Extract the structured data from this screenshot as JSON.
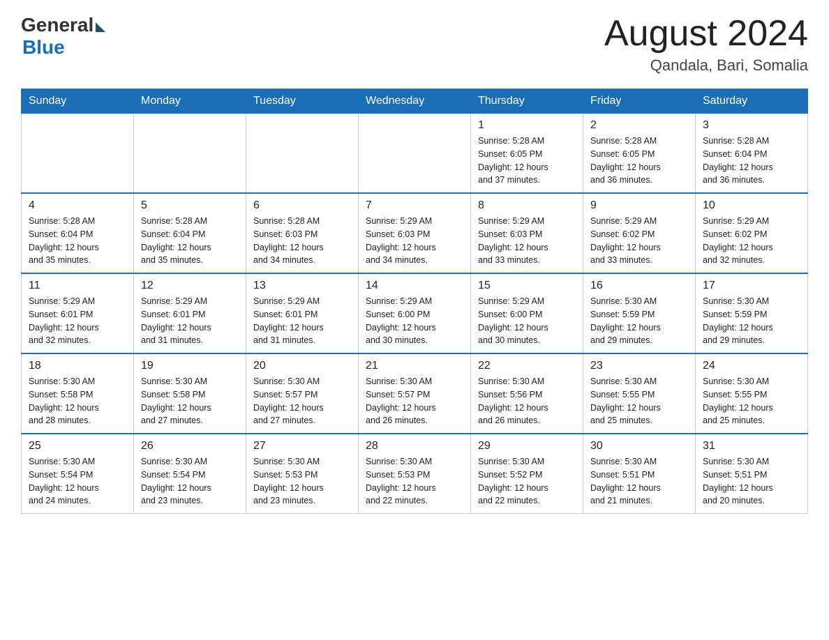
{
  "header": {
    "logo_general": "General",
    "logo_blue": "Blue",
    "month_title": "August 2024",
    "location": "Qandala, Bari, Somalia"
  },
  "days_of_week": [
    "Sunday",
    "Monday",
    "Tuesday",
    "Wednesday",
    "Thursday",
    "Friday",
    "Saturday"
  ],
  "weeks": [
    [
      {
        "day": "",
        "info": ""
      },
      {
        "day": "",
        "info": ""
      },
      {
        "day": "",
        "info": ""
      },
      {
        "day": "",
        "info": ""
      },
      {
        "day": "1",
        "info": "Sunrise: 5:28 AM\nSunset: 6:05 PM\nDaylight: 12 hours\nand 37 minutes."
      },
      {
        "day": "2",
        "info": "Sunrise: 5:28 AM\nSunset: 6:05 PM\nDaylight: 12 hours\nand 36 minutes."
      },
      {
        "day": "3",
        "info": "Sunrise: 5:28 AM\nSunset: 6:04 PM\nDaylight: 12 hours\nand 36 minutes."
      }
    ],
    [
      {
        "day": "4",
        "info": "Sunrise: 5:28 AM\nSunset: 6:04 PM\nDaylight: 12 hours\nand 35 minutes."
      },
      {
        "day": "5",
        "info": "Sunrise: 5:28 AM\nSunset: 6:04 PM\nDaylight: 12 hours\nand 35 minutes."
      },
      {
        "day": "6",
        "info": "Sunrise: 5:28 AM\nSunset: 6:03 PM\nDaylight: 12 hours\nand 34 minutes."
      },
      {
        "day": "7",
        "info": "Sunrise: 5:29 AM\nSunset: 6:03 PM\nDaylight: 12 hours\nand 34 minutes."
      },
      {
        "day": "8",
        "info": "Sunrise: 5:29 AM\nSunset: 6:03 PM\nDaylight: 12 hours\nand 33 minutes."
      },
      {
        "day": "9",
        "info": "Sunrise: 5:29 AM\nSunset: 6:02 PM\nDaylight: 12 hours\nand 33 minutes."
      },
      {
        "day": "10",
        "info": "Sunrise: 5:29 AM\nSunset: 6:02 PM\nDaylight: 12 hours\nand 32 minutes."
      }
    ],
    [
      {
        "day": "11",
        "info": "Sunrise: 5:29 AM\nSunset: 6:01 PM\nDaylight: 12 hours\nand 32 minutes."
      },
      {
        "day": "12",
        "info": "Sunrise: 5:29 AM\nSunset: 6:01 PM\nDaylight: 12 hours\nand 31 minutes."
      },
      {
        "day": "13",
        "info": "Sunrise: 5:29 AM\nSunset: 6:01 PM\nDaylight: 12 hours\nand 31 minutes."
      },
      {
        "day": "14",
        "info": "Sunrise: 5:29 AM\nSunset: 6:00 PM\nDaylight: 12 hours\nand 30 minutes."
      },
      {
        "day": "15",
        "info": "Sunrise: 5:29 AM\nSunset: 6:00 PM\nDaylight: 12 hours\nand 30 minutes."
      },
      {
        "day": "16",
        "info": "Sunrise: 5:30 AM\nSunset: 5:59 PM\nDaylight: 12 hours\nand 29 minutes."
      },
      {
        "day": "17",
        "info": "Sunrise: 5:30 AM\nSunset: 5:59 PM\nDaylight: 12 hours\nand 29 minutes."
      }
    ],
    [
      {
        "day": "18",
        "info": "Sunrise: 5:30 AM\nSunset: 5:58 PM\nDaylight: 12 hours\nand 28 minutes."
      },
      {
        "day": "19",
        "info": "Sunrise: 5:30 AM\nSunset: 5:58 PM\nDaylight: 12 hours\nand 27 minutes."
      },
      {
        "day": "20",
        "info": "Sunrise: 5:30 AM\nSunset: 5:57 PM\nDaylight: 12 hours\nand 27 minutes."
      },
      {
        "day": "21",
        "info": "Sunrise: 5:30 AM\nSunset: 5:57 PM\nDaylight: 12 hours\nand 26 minutes."
      },
      {
        "day": "22",
        "info": "Sunrise: 5:30 AM\nSunset: 5:56 PM\nDaylight: 12 hours\nand 26 minutes."
      },
      {
        "day": "23",
        "info": "Sunrise: 5:30 AM\nSunset: 5:55 PM\nDaylight: 12 hours\nand 25 minutes."
      },
      {
        "day": "24",
        "info": "Sunrise: 5:30 AM\nSunset: 5:55 PM\nDaylight: 12 hours\nand 25 minutes."
      }
    ],
    [
      {
        "day": "25",
        "info": "Sunrise: 5:30 AM\nSunset: 5:54 PM\nDaylight: 12 hours\nand 24 minutes."
      },
      {
        "day": "26",
        "info": "Sunrise: 5:30 AM\nSunset: 5:54 PM\nDaylight: 12 hours\nand 23 minutes."
      },
      {
        "day": "27",
        "info": "Sunrise: 5:30 AM\nSunset: 5:53 PM\nDaylight: 12 hours\nand 23 minutes."
      },
      {
        "day": "28",
        "info": "Sunrise: 5:30 AM\nSunset: 5:53 PM\nDaylight: 12 hours\nand 22 minutes."
      },
      {
        "day": "29",
        "info": "Sunrise: 5:30 AM\nSunset: 5:52 PM\nDaylight: 12 hours\nand 22 minutes."
      },
      {
        "day": "30",
        "info": "Sunrise: 5:30 AM\nSunset: 5:51 PM\nDaylight: 12 hours\nand 21 minutes."
      },
      {
        "day": "31",
        "info": "Sunrise: 5:30 AM\nSunset: 5:51 PM\nDaylight: 12 hours\nand 20 minutes."
      }
    ]
  ]
}
